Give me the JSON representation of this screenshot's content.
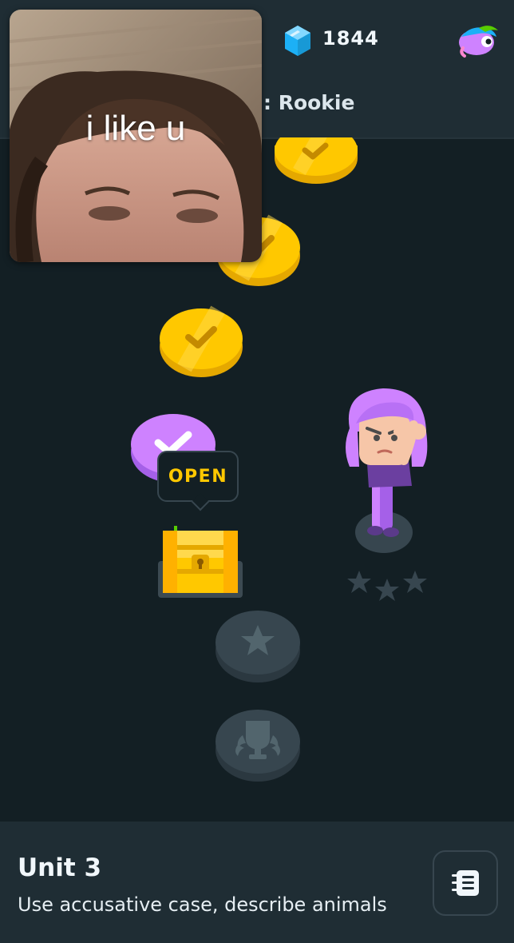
{
  "header": {
    "gem_count": "1844",
    "section_label": ": Rookie",
    "icons": [
      "gem-icon",
      "mascot-icon"
    ]
  },
  "webcam": {
    "caption": "i like u"
  },
  "path": {
    "nodes": [
      {
        "type": "lesson",
        "state": "completed",
        "color": "#ffc800"
      },
      {
        "type": "lesson",
        "state": "completed",
        "color": "#ffc800"
      },
      {
        "type": "lesson",
        "state": "completed",
        "color": "#ffc800"
      },
      {
        "type": "lesson",
        "state": "current",
        "color": "#ce82ff"
      },
      {
        "type": "chest",
        "state": "unlocked"
      },
      {
        "type": "lesson",
        "state": "locked",
        "icon": "star-icon"
      },
      {
        "type": "unit-review",
        "state": "locked",
        "icon": "trophy-icon"
      }
    ],
    "tooltip": "OPEN",
    "character_rating": {
      "filled": 0,
      "total": 3
    }
  },
  "footer": {
    "unit_title": "Unit 3",
    "unit_description": "Use accusative case, describe animals",
    "guidebook_icon": "guidebook-icon"
  },
  "colors": {
    "background": "#131f24",
    "panel": "#1f2d34",
    "gold": "#ffc800",
    "purple": "#ce82ff",
    "locked": "#37464f"
  }
}
